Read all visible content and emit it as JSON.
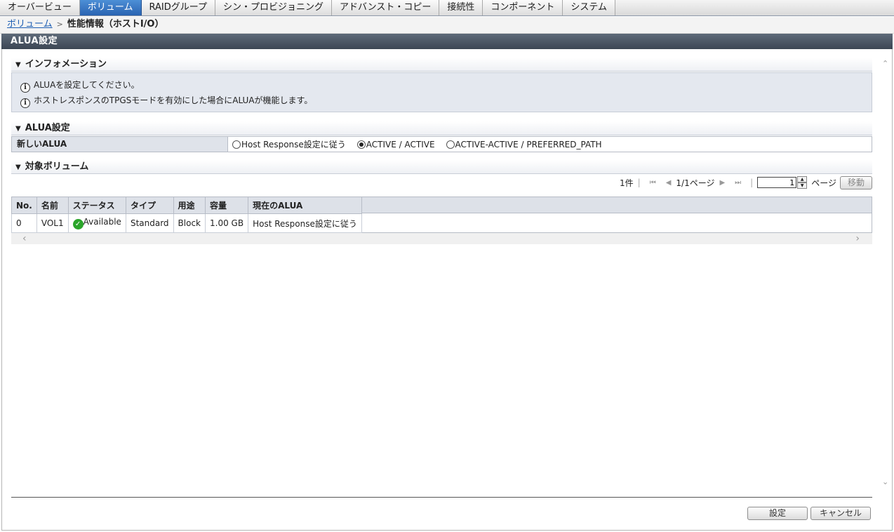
{
  "tabs": [
    {
      "label": "オーバービュー",
      "active": false
    },
    {
      "label": "ボリューム",
      "active": true
    },
    {
      "label": "RAIDグループ",
      "active": false
    },
    {
      "label": "シン・プロビジョニング",
      "active": false
    },
    {
      "label": "アドバンスト・コピー",
      "active": false
    },
    {
      "label": "接続性",
      "active": false
    },
    {
      "label": "コンポーネント",
      "active": false
    },
    {
      "label": "システム",
      "active": false
    }
  ],
  "breadcrumb": {
    "root": "ボリューム",
    "separator": ">",
    "current": "性能情報（ホストI/O）"
  },
  "title": "ALUA設定",
  "info_section": {
    "heading": "インフォメーション",
    "messages": [
      "ALUAを設定してください。",
      "ホストレスポンスのTPGSモードを有効にした場合にALUAが機能します。"
    ]
  },
  "alua_section": {
    "heading": "ALUA設定",
    "field_label": "新しいALUA",
    "options": [
      "Host Response設定に従う",
      "ACTIVE / ACTIVE",
      "ACTIVE-ACTIVE / PREFERRED_PATH"
    ],
    "selected": "ACTIVE / ACTIVE"
  },
  "volume_section": {
    "heading": "対象ボリューム",
    "pager": {
      "count": "1件",
      "page_info": "1/1ページ",
      "page_input": "1",
      "page_suffix": "ページ",
      "go_button": "移動"
    },
    "columns": [
      "No.",
      "名前",
      "ステータス",
      "タイプ",
      "用途",
      "容量",
      "現在のALUA"
    ],
    "rows": [
      {
        "no": "0",
        "name": "VOL1",
        "status": "Available",
        "type": "Standard",
        "usage": "Block",
        "capacity": "1.00 GB",
        "alua": "Host Response設定に従う"
      }
    ]
  },
  "buttons": {
    "set": "設定",
    "cancel": "キャンセル"
  },
  "colors": {
    "active_tab": "#2a64b2",
    "title_bar": "#3c4654",
    "status_ok": "#2aa52a"
  }
}
